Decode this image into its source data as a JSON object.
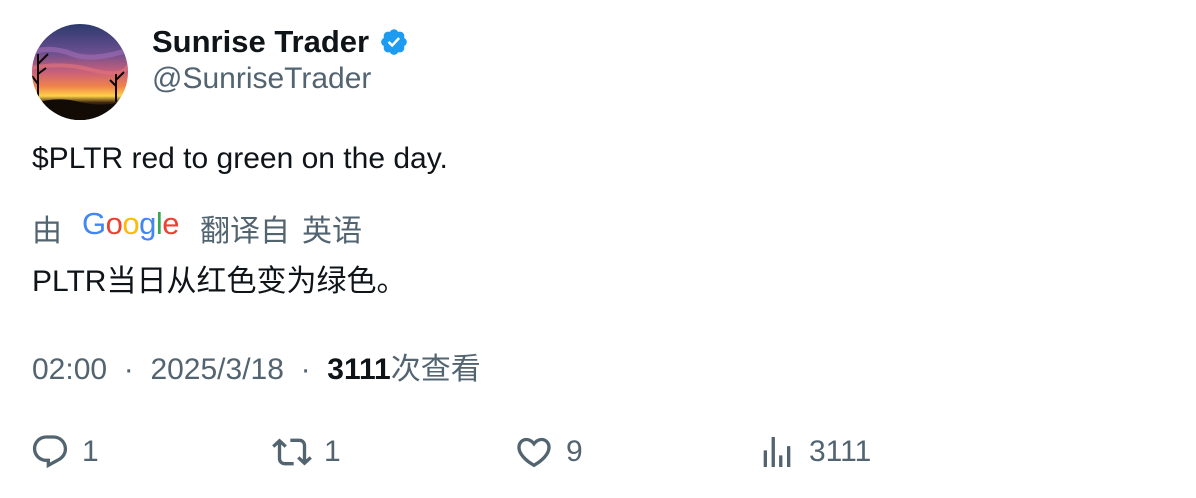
{
  "author": {
    "display_name": "Sunrise Trader",
    "handle": "@SunriseTrader",
    "verified": true
  },
  "tweet": {
    "text": "$PLTR red to green on the day."
  },
  "translation": {
    "by_label": "由",
    "provider": "Google",
    "translated_from": "翻译自",
    "source_language": "英语",
    "text": "PLTR当日从红色变为绿色。"
  },
  "meta": {
    "time": "02:00",
    "separator": "·",
    "date": "2025/3/18",
    "views_count": "3111",
    "views_label": "次查看"
  },
  "actions": {
    "reply_count": "1",
    "retweet_count": "1",
    "like_count": "9",
    "views_count": "3111"
  },
  "icons": {
    "verified": "verified-badge-icon",
    "reply": "reply-icon",
    "retweet": "retweet-icon",
    "like": "heart-icon",
    "views": "analytics-bar-icon"
  },
  "colors": {
    "text_primary": "#0f1419",
    "text_secondary": "#536471",
    "verified_blue": "#1d9bf0"
  }
}
